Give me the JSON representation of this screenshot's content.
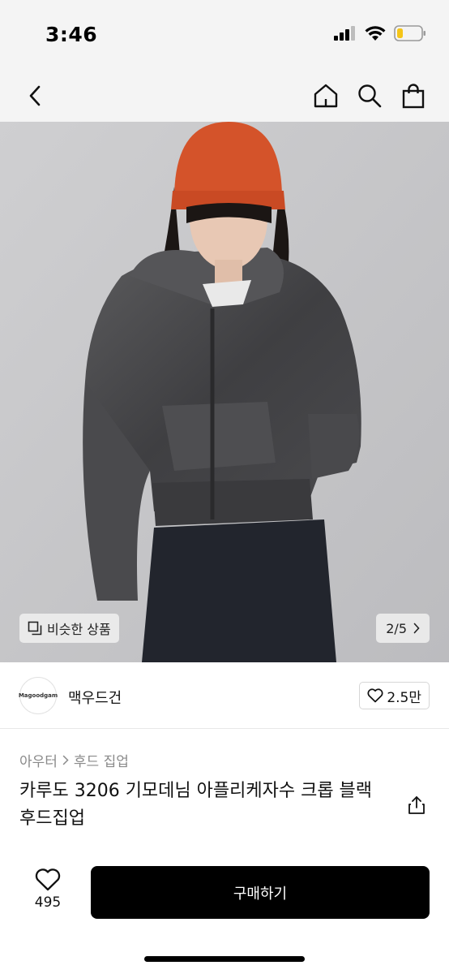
{
  "status": {
    "time": "3:46",
    "icons": [
      "cellular-signal-icon",
      "wifi-icon",
      "battery-icon"
    ],
    "battery_color": "#f5c518"
  },
  "nav": {
    "icons": [
      "back-chevron-icon",
      "home-icon",
      "search-icon",
      "shopping-bag-icon"
    ]
  },
  "gallery": {
    "similar_label": "비슷한 상품",
    "page_indicator": "2/5",
    "hat_color": "#d4532a"
  },
  "shop": {
    "avatar_text": "Magoodgam",
    "name": "맥우드건",
    "like_count": "2.5만"
  },
  "product": {
    "breadcrumb": [
      "아우터",
      "후드 집업"
    ],
    "title": "카루도 3206 기모데님 아플리케자수 크롭 블랙 후드집업"
  },
  "bottom": {
    "wish_count": "495",
    "buy_label": "구매하기",
    "buy_color": "#000000"
  }
}
